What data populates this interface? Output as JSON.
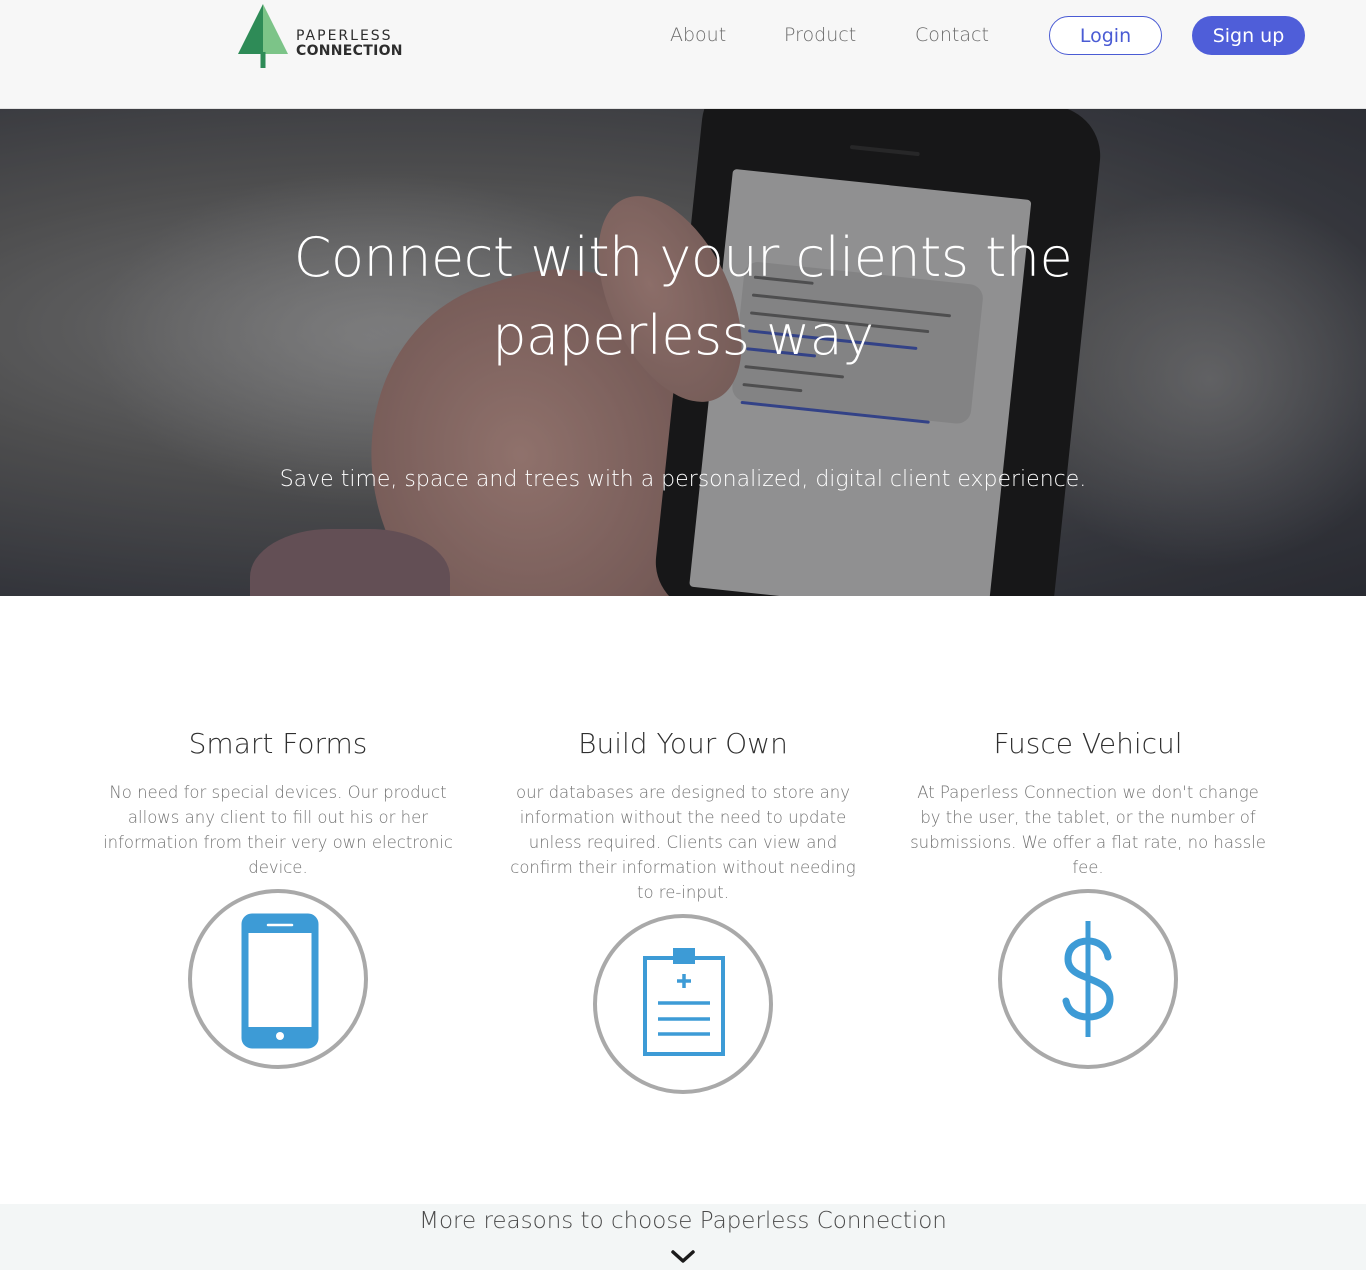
{
  "brand": {
    "name_line1": "PAPERLESS",
    "name_line2": "CONNECTION",
    "tree_color_dark": "#2e8b57",
    "tree_color_light": "#7cc488"
  },
  "nav": {
    "links": [
      {
        "label": "About"
      },
      {
        "label": "Product"
      },
      {
        "label": "Contact"
      }
    ],
    "login_label": "Login",
    "signup_label": "Sign up",
    "accent_color": "#4f5ed9"
  },
  "hero": {
    "title": "Connect with your clients the paperless way",
    "subtitle": "Save time, space and trees with a personalized, digital client experience."
  },
  "features": [
    {
      "title": "Smart Forms",
      "text": "No need for special devices. Our product allows any client to fill out his or her information from their very own electronic device.",
      "icon": "smartphone-icon"
    },
    {
      "title": "Build Your Own",
      "text": "our databases are designed to store any information without the need to update unless required. Clients can view and confirm their information without needing to re-input.",
      "icon": "clipboard-icon"
    },
    {
      "title": "Fusce Vehicul",
      "text": "At Paperless Connection we don't change by the user, the tablet, or the number of submissions. We offer a flat rate, no hassle fee.",
      "icon": "dollar-icon"
    }
  ],
  "icon_color": "#3d9bd6",
  "more": {
    "label": "More reasons to choose Paperless Connection",
    "icon": "chevron-down-icon"
  }
}
